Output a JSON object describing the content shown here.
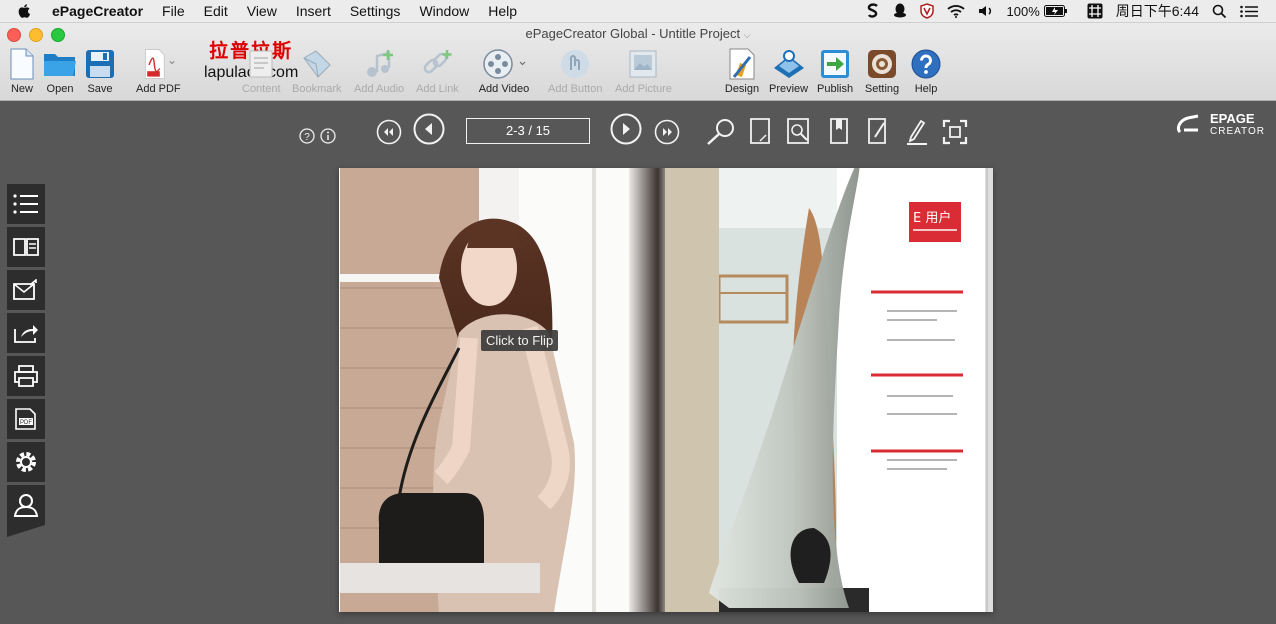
{
  "menubar": {
    "app_name": "ePageCreator",
    "items": [
      "File",
      "Edit",
      "View",
      "Insert",
      "Settings",
      "Window",
      "Help"
    ],
    "battery": "100%",
    "clock": "周日下午6:44"
  },
  "window": {
    "title": "ePageCreator Global - Untitle Project"
  },
  "toolbar": {
    "new": "New",
    "open": "Open",
    "save": "Save",
    "add_pdf": "Add PDF",
    "content": "Content",
    "bookmark": "Bookmark",
    "add_audio": "Add Audio",
    "add_link": "Add Link",
    "add_video": "Add Video",
    "add_button": "Add Button",
    "add_picture": "Add Picture",
    "design": "Design",
    "preview": "Preview",
    "publish": "Publish",
    "setting": "Setting",
    "help": "Help"
  },
  "watermark": {
    "cn": "拉普拉斯",
    "en": "lapulace.com"
  },
  "viewer": {
    "page_indicator": "2-3 / 15",
    "tooltip": "Click to Flip"
  },
  "logo": {
    "line1": "EPAGE",
    "line2": "CREATOR"
  },
  "book_right_page": {
    "heading_fragment": "E 用户"
  },
  "colors": {
    "accent_red": "#d92c34",
    "viewer_bg": "#575757",
    "sidebar": "#2d2d2d"
  }
}
